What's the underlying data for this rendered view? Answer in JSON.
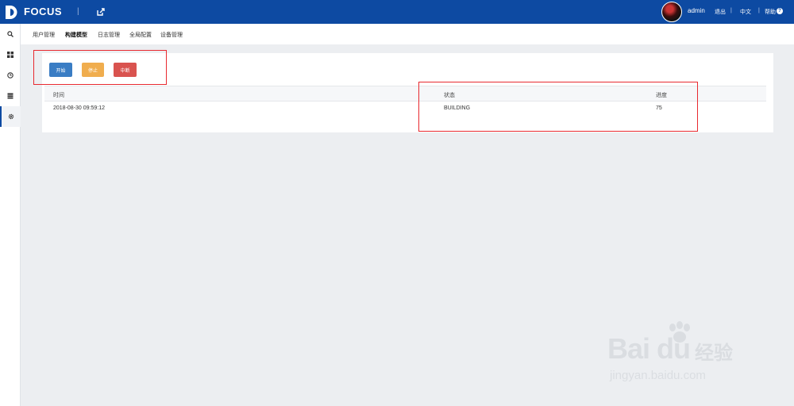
{
  "header": {
    "brand": "FOCUS",
    "separator": "|",
    "user": "admin",
    "logout": "退出",
    "divider": "|",
    "language": "中文",
    "help": "帮助",
    "help_icon_glyph": "?"
  },
  "subnav": {
    "items": [
      {
        "label": "用户管理",
        "active": false
      },
      {
        "label": "构建模型",
        "active": true
      },
      {
        "label": "日志管理",
        "active": false
      },
      {
        "label": "全局配置",
        "active": false
      },
      {
        "label": "设备管理",
        "active": false
      }
    ]
  },
  "sidebar": {
    "items": [
      {
        "icon": "search-icon",
        "active": false
      },
      {
        "icon": "grid-icon",
        "active": false
      },
      {
        "icon": "clock-icon",
        "active": false
      },
      {
        "icon": "table-icon",
        "active": false
      },
      {
        "icon": "gear-icon",
        "active": true
      }
    ]
  },
  "actions": {
    "start": "开始",
    "stop": "停止",
    "interrupt": "中断"
  },
  "table": {
    "columns": [
      "时间",
      "状态",
      "进度"
    ],
    "rows": [
      [
        "2018-08-30 09:59:12",
        "BUILDING",
        "75"
      ]
    ]
  },
  "watermark": {
    "brand": "Bai du",
    "cn": "经验",
    "url": "jingyan.baidu.com"
  },
  "colors": {
    "header_bg": "#0d4aa2",
    "start": "#3a7dc4",
    "stop": "#f0ad4e",
    "interrupt": "#d9534f",
    "highlight": "#e8292f"
  }
}
